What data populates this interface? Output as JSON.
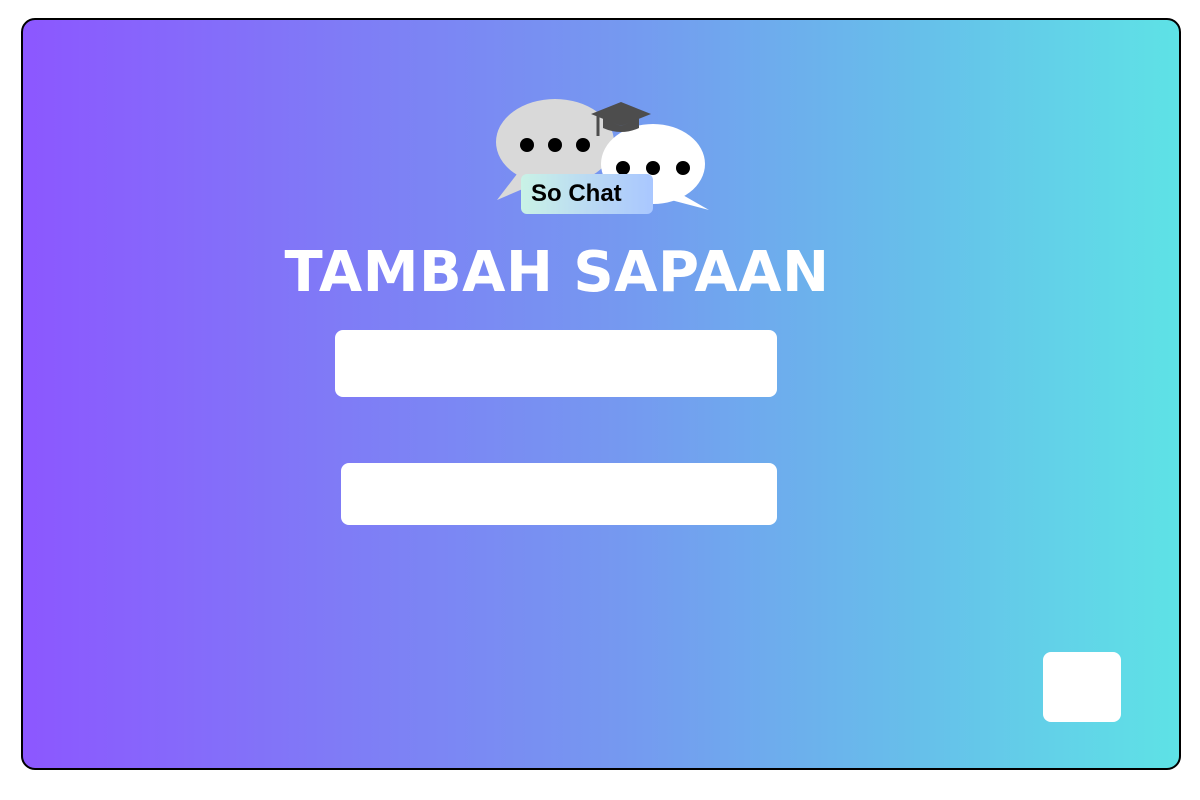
{
  "logo": {
    "label": "So Chat",
    "icons": [
      "chat-bubble-icon",
      "graduation-cap-icon"
    ]
  },
  "page": {
    "title": "TAMBAH SAPAAN"
  },
  "form": {
    "field_1": {
      "value": "",
      "placeholder": ""
    },
    "field_2": {
      "value": "",
      "placeholder": ""
    },
    "submit_label": ""
  },
  "colors": {
    "gradient_start": "#8c57ff",
    "gradient_end": "#5ee2e6",
    "bubble_back": "#d9d9d9",
    "bubble_front": "#ffffff",
    "cap": "#4d4d4d",
    "title_text": "#ffffff"
  }
}
